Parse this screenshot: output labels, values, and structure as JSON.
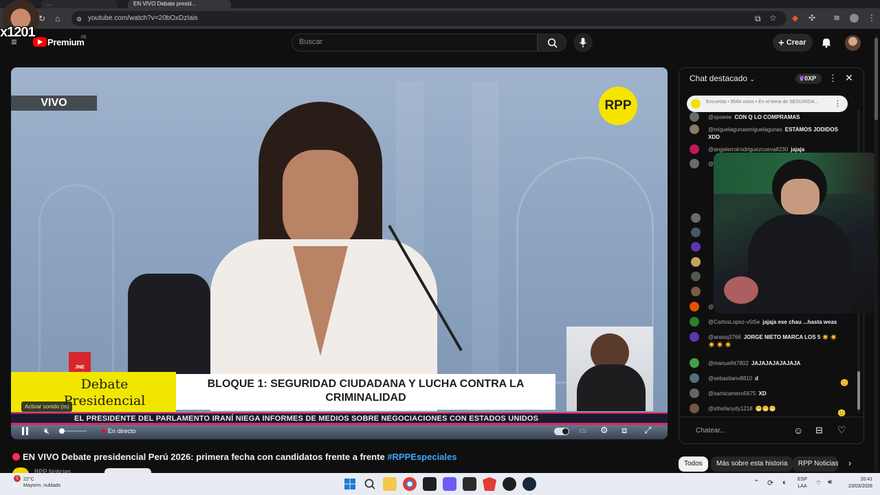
{
  "browser": {
    "url": "youtube.com/watch?v=20bOxDzIais",
    "tabs": [
      "...",
      "EN VIVO Debate presid..."
    ]
  },
  "youtube": {
    "logo_text": "Premium",
    "logo_region": "PE",
    "search_placeholder": "Buscar",
    "create_label": "Crear"
  },
  "overlay": {
    "streamer_name": "x1201"
  },
  "video": {
    "live_badge": "VIVO",
    "channel_logo": "RPP",
    "jne_label": "JNE",
    "lower_third_title": "Debate Presidencial",
    "lower_third_topic": "BLOQUE 1: SEGURIDAD CIUDADANA Y LUCHA CONTRA LA CRIMINALIDAD",
    "ticker": "EL PRESIDENTE DEL PARLAMENTO IRANÍ NIEGA INFORMES DE MEDIOS SOBRE NEGOCIACIONES CON ESTADOS UNIDOS",
    "tooltip": "Activar sonido (m)",
    "live_label": "En directo"
  },
  "title": {
    "text": "EN VIVO Debate presidencial Perú 2026: primera fecha con candidatos frente a frente",
    "hashtag": "#RPPEspeciales",
    "channel": "RPP Noticias"
  },
  "chat": {
    "header": "Chat destacado",
    "points": "0XP",
    "poll": "Encuesta • 9564 votos • En el tema de SEGURIDA...",
    "input_placeholder": "Chatear...",
    "messages": [
      {
        "user": "@spoeee",
        "text": "CON Q LO COMPRAMAS",
        "color": "#6b6b6b"
      },
      {
        "user": "@miguelagunasmiguelagunas",
        "text": "ESTAMOS JODIDOS XDD",
        "color": "#8a7a66"
      },
      {
        "user": "@angelerrolrodriguezcueva8230",
        "text": "jajaja",
        "color": "#c2185b"
      },
      {
        "user": "@fab",
        "text": "",
        "color": "#6b6b6b"
      },
      {
        "user": "@ke",
        "text": "",
        "color": "#e65100"
      },
      {
        "user": "@CarlosLopez-v5t5e",
        "text": "jajaja ese chau ...hasta weas",
        "color": "#2e7d32"
      },
      {
        "user": "@anasq3766",
        "text": "JORGE NIETO MARCA LOS 5 ☀️ ☀️ ☀️ ☀️ ☀️",
        "color": "#5e35b1"
      },
      {
        "user": "@manuelht7802",
        "text": "JAJAJAJAJAJAJA",
        "color": "#43a047"
      },
      {
        "user": "@sebastianv8810",
        "text": "d",
        "color": "#546e7a"
      },
      {
        "user": "@samicamero5675",
        "text": "XD",
        "color": "#666"
      },
      {
        "user": "@sthefanydy1218",
        "text": "😬😬😬",
        "color": "#795548"
      }
    ]
  },
  "chips": [
    "Todos",
    "Más sobre esta historia",
    "RPP Noticias"
  ],
  "taskbar": {
    "weather_temp": "22°C",
    "weather_desc": "Mayorm. nublado",
    "lang_top": "ESP",
    "lang_bottom": "LAA",
    "time": "20:41",
    "date": "23/03/2026",
    "notification_count": "1"
  }
}
